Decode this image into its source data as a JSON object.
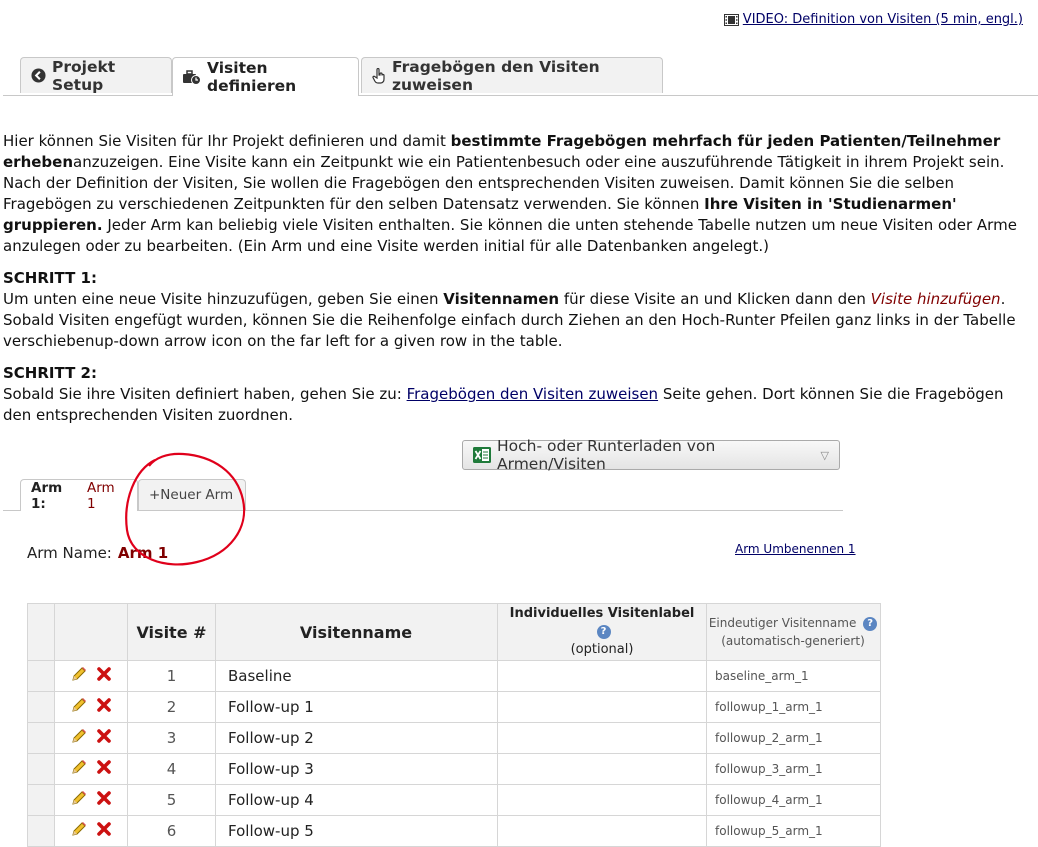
{
  "video": {
    "label": "VIDEO: Definition von Visiten (5 min, engl.)",
    "icon": "film-icon"
  },
  "tabs": [
    {
      "label": "Projekt Setup",
      "icon": "chevron-circle-left-icon"
    },
    {
      "label": "Visiten definieren",
      "icon": "briefcase-clock-icon"
    },
    {
      "label": "Fragebögen den Visiten zuweisen",
      "icon": "pointer-hand-icon"
    }
  ],
  "intro": {
    "p1_a": "Hier können Sie Visiten für Ihr Projekt definieren und damit ",
    "p1_b": "bestimmte Fragebögen mehrfach für jeden Patienten/Teilnehmer erheben",
    "p1_c": "anzuzeigen. Eine Visite kann ein Zeitpunkt wie ein Patientenbesuch oder eine auszuführende Tätigkeit in ihrem Projekt sein. Nach der Definition der Visiten, Sie wollen die Fragebögen den entsprechenden Visiten zuweisen. Damit können Sie die selben Fragebögen zu verschiedenen Zeitpunkten für den selben Datensatz verwenden. Sie können ",
    "p1_d": "Ihre Visiten in 'Studienarmen' gruppieren.",
    "p1_e": " Jeder Arm kan beliebig viele Visiten enthalten. Sie können die unten stehende Tabelle nutzen um neue Visiten oder Arme anzulegen oder zu bearbeiten. (Ein Arm und eine Visite werden initial für alle Datenbanken angelegt.)",
    "step1_title": "SCHRITT 1:",
    "step1_a": "Um unten eine neue Visite hinzuzufügen, geben Sie einen ",
    "step1_b": "Visitennamen",
    "step1_c": " für diese Visite an und Klicken dann den ",
    "step1_d": "Visite hinzufügen",
    "step1_e": ". Sobald Visiten engefügt wurden, können Sie die Reihenfolge einfach durch Ziehen an den Hoch-Runter Pfeilen ganz links in der Tabelle verschiebenup-down arrow icon on the far left for a given row in the table.",
    "step2_title": "SCHRITT 2:",
    "step2_a": "Sobald Sie ihre Visiten definiert haben, gehen Sie zu: ",
    "step2_link": "Fragebögen den Visiten zuweisen",
    "step2_b": " Seite gehen. Dort können Sie die Fragebögen den entsprechenden Visiten zuordnen."
  },
  "download_button": {
    "label": "Hoch- oder Runterladen von Armen/Visiten",
    "icon": "excel-icon"
  },
  "arm_tabs": {
    "active_label": "Arm 1:",
    "active_value": "Arm 1",
    "new_label": "+Neuer Arm"
  },
  "arm": {
    "name_label": "Arm Name:",
    "name_value": "Arm 1",
    "rename_link": "Arm Umbenennen 1"
  },
  "table": {
    "headers": {
      "visit_num": "Visite #",
      "visit_name": "Visitenname",
      "custom_label": "Individuelles Visitenlabel",
      "custom_label_sub": "(optional)",
      "unique_name": "Eindeutiger Visitenname",
      "unique_name_sub": "(automatisch-generiert)"
    },
    "rows": [
      {
        "num": "1",
        "name": "Baseline",
        "custom": "",
        "unique": "baseline_arm_1"
      },
      {
        "num": "2",
        "name": "Follow-up 1",
        "custom": "",
        "unique": "followup_1_arm_1"
      },
      {
        "num": "3",
        "name": "Follow-up 2",
        "custom": "",
        "unique": "followup_2_arm_1"
      },
      {
        "num": "4",
        "name": "Follow-up 3",
        "custom": "",
        "unique": "followup_3_arm_1"
      },
      {
        "num": "5",
        "name": "Follow-up 4",
        "custom": "",
        "unique": "followup_4_arm_1"
      },
      {
        "num": "6",
        "name": "Follow-up 5",
        "custom": "",
        "unique": "followup_5_arm_1"
      }
    ]
  },
  "colors": {
    "link": "#000066",
    "accent_red": "#800000",
    "annotation": "#e0001b",
    "delete": "#cc1111"
  }
}
